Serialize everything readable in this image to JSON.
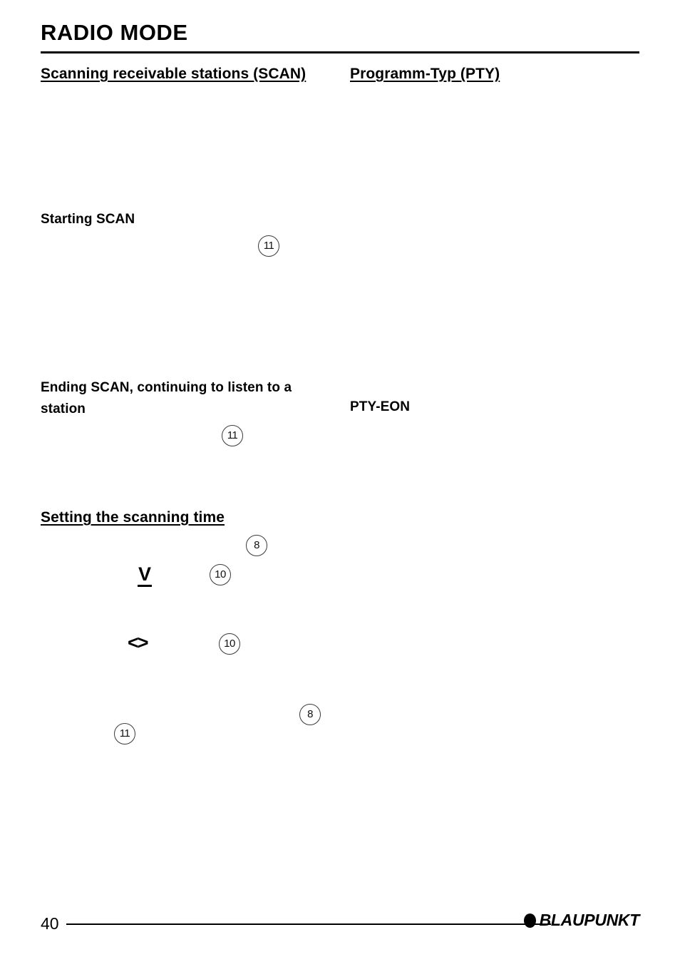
{
  "document": {
    "title": "RADIO MODE",
    "page_number": "40",
    "brand": "BLAUPUNKT"
  },
  "left_column": {
    "section_heading": "Scanning receivable stations (SCAN)",
    "subheading_start": "Starting SCAN",
    "subheading_end": "Ending SCAN, continuing to listen to a station",
    "section_heading_time": "Setting the scanning time"
  },
  "right_column": {
    "section_heading": "Programm-Typ (PTY)",
    "subheading_pty_eon": "PTY-EON"
  },
  "callouts": {
    "start_scan": "11",
    "end_scan": "11",
    "time_eight_top": "8",
    "time_ten_top": "10",
    "time_ten_bottom": "10",
    "time_eight_bottom": "8",
    "time_eleven": "11"
  },
  "key_symbols": {
    "down_arrow": "V",
    "left_right": "<>"
  }
}
